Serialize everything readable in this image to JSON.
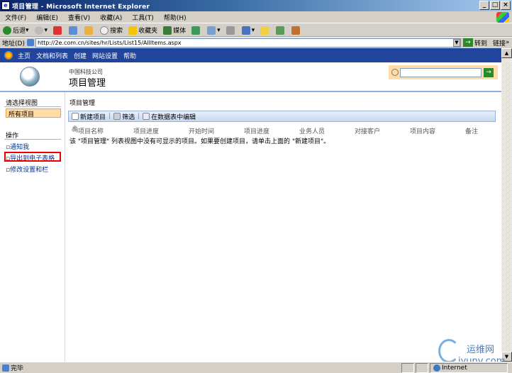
{
  "window": {
    "title": "项目管理 - Microsoft Internet Explorer",
    "buttons": [
      "_",
      "□",
      "×"
    ]
  },
  "menu": [
    "文件(F)",
    "编辑(E)",
    "查看(V)",
    "收藏(A)",
    "工具(T)",
    "帮助(H)"
  ],
  "toolbar": {
    "back": "后退",
    "search": "搜索",
    "favorites": "收藏夹",
    "media": "媒体"
  },
  "address": {
    "label": "地址(D)",
    "url": "http://2e.com.cn/sites/hr/Lists/List15/AllItems.aspx",
    "go": "转到",
    "links": "链接"
  },
  "spnav": [
    "主页",
    "文档和列表",
    "创建",
    "网站设置",
    "帮助"
  ],
  "header": {
    "site_name": "中国科技公司",
    "page_title": "项目管理",
    "search_go": "→"
  },
  "leftnav": {
    "views_heading": "请选择视图",
    "current_view": "所有项目",
    "actions_heading": "操作",
    "actions": [
      "通知我",
      "导出到电子表格",
      "修改设置和栏"
    ]
  },
  "main": {
    "breadcrumb": "项目管理",
    "toolbar": [
      "新建项目",
      "筛选",
      "在数据表中编辑"
    ],
    "columns": [
      "项目名称",
      "项目进度",
      "开始时间",
      "项目进度",
      "业务人员",
      "对接客户",
      "项目内容",
      "备注"
    ],
    "empty_message": "该 \"项目管理\" 列表视图中没有可显示的项目。如果要创建项目，请单击上面的 \"新建项目\"。"
  },
  "status": {
    "left": "完毕",
    "zone": "Internet"
  },
  "watermark": {
    "cn": "运维网",
    "url": "iyunv.com"
  }
}
